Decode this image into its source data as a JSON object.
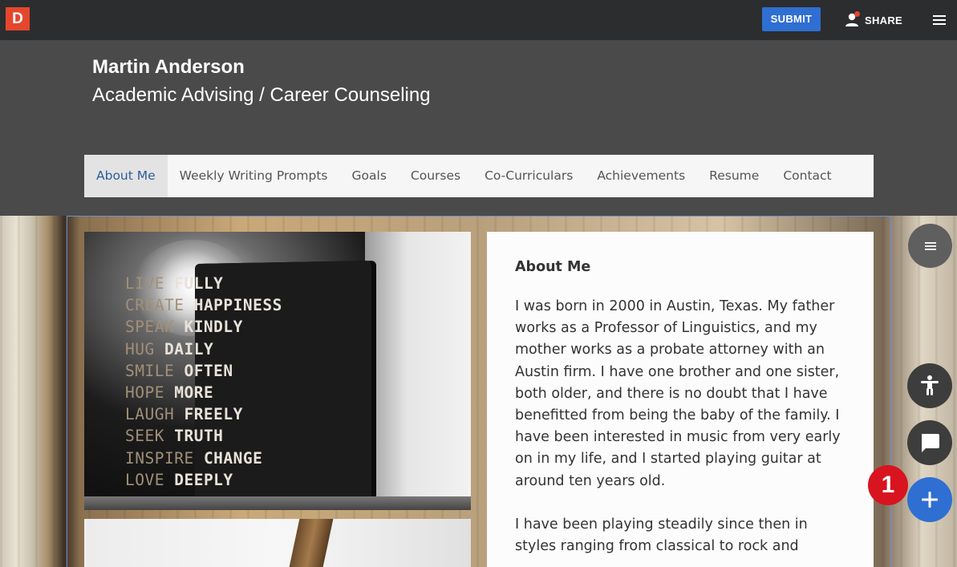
{
  "topbar": {
    "logo_letter": "D",
    "submit_label": "SUBMIT",
    "share_label": "SHARE",
    "colors": {
      "bar": "#2c2d2f",
      "logo": "#e5472d",
      "submit": "#2f6fd1"
    }
  },
  "header": {
    "name": "Martin Anderson",
    "subtitle": "Academic Advising / Career Counseling"
  },
  "nav": {
    "items": [
      {
        "label": "About Me",
        "active": true
      },
      {
        "label": "Weekly Writing Prompts",
        "active": false
      },
      {
        "label": "Goals",
        "active": false
      },
      {
        "label": "Courses",
        "active": false
      },
      {
        "label": "Co-Curriculars",
        "active": false
      },
      {
        "label": "Achievements",
        "active": false
      },
      {
        "label": "Resume",
        "active": false
      },
      {
        "label": "Contact",
        "active": false
      }
    ]
  },
  "photo": {
    "quote_lines": [
      {
        "a": "LIVE",
        "b": "FULLY"
      },
      {
        "a": "CREATE",
        "b": "HAPPINESS"
      },
      {
        "a": "SPEAK",
        "b": "KINDLY"
      },
      {
        "a": "HUG",
        "b": "DAILY"
      },
      {
        "a": "SMILE",
        "b": "OFTEN"
      },
      {
        "a": "HOPE",
        "b": "MORE"
      },
      {
        "a": "LAUGH",
        "b": "FREELY"
      },
      {
        "a": "SEEK",
        "b": "TRUTH"
      },
      {
        "a": "INSPIRE",
        "b": "CHANGE"
      },
      {
        "a": "LOVE",
        "b": "DEEPLY"
      }
    ]
  },
  "about": {
    "heading": "About Me",
    "paragraph1": "I was born in 2000 in Austin, Texas. My father works as a Professor of Linguistics, and my mother works as a probate attorney with an Austin firm. I have one brother and one sister, both older, and there is no doubt that I have benefitted from being the baby of the family. I have been interested in music from very early on in my life, and I started playing guitar at around ten years old.",
    "paragraph2": "I have been playing steadily since then in styles ranging from classical to rock and"
  },
  "fabs": {
    "list_icon": "list-icon",
    "accessibility_icon": "accessibility-icon",
    "chat_icon": "chat-icon",
    "add_icon": "plus-icon",
    "badge_count": "1"
  }
}
